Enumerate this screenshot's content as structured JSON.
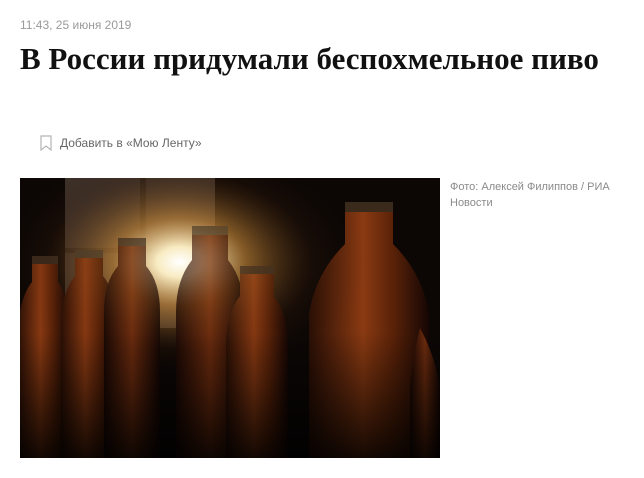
{
  "article": {
    "timestamp": "11:43, 25 июня 2019",
    "headline": "В России придумали беспохмельное пиво",
    "add_to_feed_label": "Добавить в «Мою Ленту»",
    "add_to_feed_icon": "bookmark-icon",
    "photo_caption": "Фото: Алексей Филиппов / РИА Новости"
  }
}
